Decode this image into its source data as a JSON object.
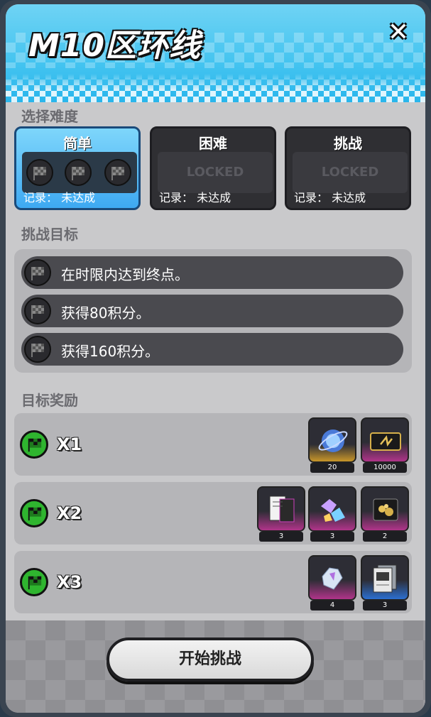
{
  "title": "M10区环线",
  "close_label": "✕",
  "difficulty_section": {
    "label": "选择难度",
    "cards": [
      {
        "name": "简单",
        "record": "记录：  未达成",
        "locked_text": ""
      },
      {
        "name": "困难",
        "record": "记录：  未达成",
        "locked_text": "LOCKED"
      },
      {
        "name": "挑战",
        "record": "记录：  未达成",
        "locked_text": "LOCKED"
      }
    ]
  },
  "objectives_section": {
    "label": "挑战目标",
    "items": [
      {
        "text": "在时限内达到终点。"
      },
      {
        "text": "获得80积分。"
      },
      {
        "text": "获得160积分。"
      }
    ]
  },
  "rewards_section": {
    "label": "目标奖励",
    "tiers": [
      {
        "multiplier": "X1",
        "items": [
          {
            "qty": "20",
            "icon": "sphere-icon"
          },
          {
            "qty": "10000",
            "icon": "ticket-icon"
          }
        ]
      },
      {
        "multiplier": "X2",
        "items": [
          {
            "qty": "3",
            "icon": "blueprint-icon"
          },
          {
            "qty": "3",
            "icon": "crystal-shards-icon"
          },
          {
            "qty": "2",
            "icon": "gold-box-icon"
          }
        ]
      },
      {
        "multiplier": "X3",
        "items": [
          {
            "qty": "4",
            "icon": "diamond-icon"
          },
          {
            "qty": "3",
            "icon": "document-icon"
          }
        ]
      }
    ]
  },
  "start_button": "开始挑战"
}
